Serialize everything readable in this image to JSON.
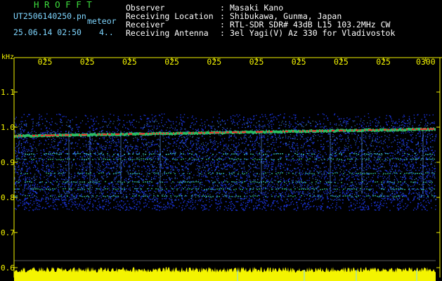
{
  "header": {
    "brand": "H R O F F T",
    "filename": "UT2506140250.pn",
    "type": "meteor",
    "datetime": "25.06.14 02:50",
    "marker": "4.."
  },
  "meta": [
    {
      "key": "Observer",
      "value": "Masaki Kano"
    },
    {
      "key": "Receiving Location",
      "value": "Shibukawa, Gunma, Japan"
    },
    {
      "key": "Receiver",
      "value": "RTL-SDR SDR# 43dB L15 103.2MHz CW"
    },
    {
      "key": "Receiving Antenna",
      "value": "3el Yagi(V) Az 330 for Vladivostok"
    }
  ],
  "meta_separator": ":",
  "colors": {
    "text_green": "#3ddc3d",
    "text_cyan": "#7fd6ff",
    "text_white": "#ffffff",
    "axis_yellow": "#f4f400",
    "background": "#000000",
    "noise": "#1f3cff",
    "echo": "#ff2a2a"
  },
  "chart_data": {
    "type": "heatmap",
    "ylabel": "kHz",
    "x_tick_labels": [
      "025",
      "025",
      "025",
      "025",
      "025",
      "025",
      "025",
      "025",
      "025",
      "0300"
    ],
    "y_ticks": [
      1.1,
      1.0,
      0.9,
      0.8,
      0.7,
      0.6
    ],
    "y_tick_labels": [
      "1.1",
      "1.0",
      "0.9",
      "0.8",
      "0.7",
      "0.6"
    ],
    "ylim": [
      0.6,
      1.12
    ],
    "carrier_freq_start": 0.975,
    "carrier_freq_end": 0.995,
    "noise_band": [
      0.8,
      1.04
    ],
    "faint_lines_khz": [
      0.925,
      0.91,
      0.87,
      0.845,
      0.825,
      0.805
    ],
    "grid": false
  }
}
